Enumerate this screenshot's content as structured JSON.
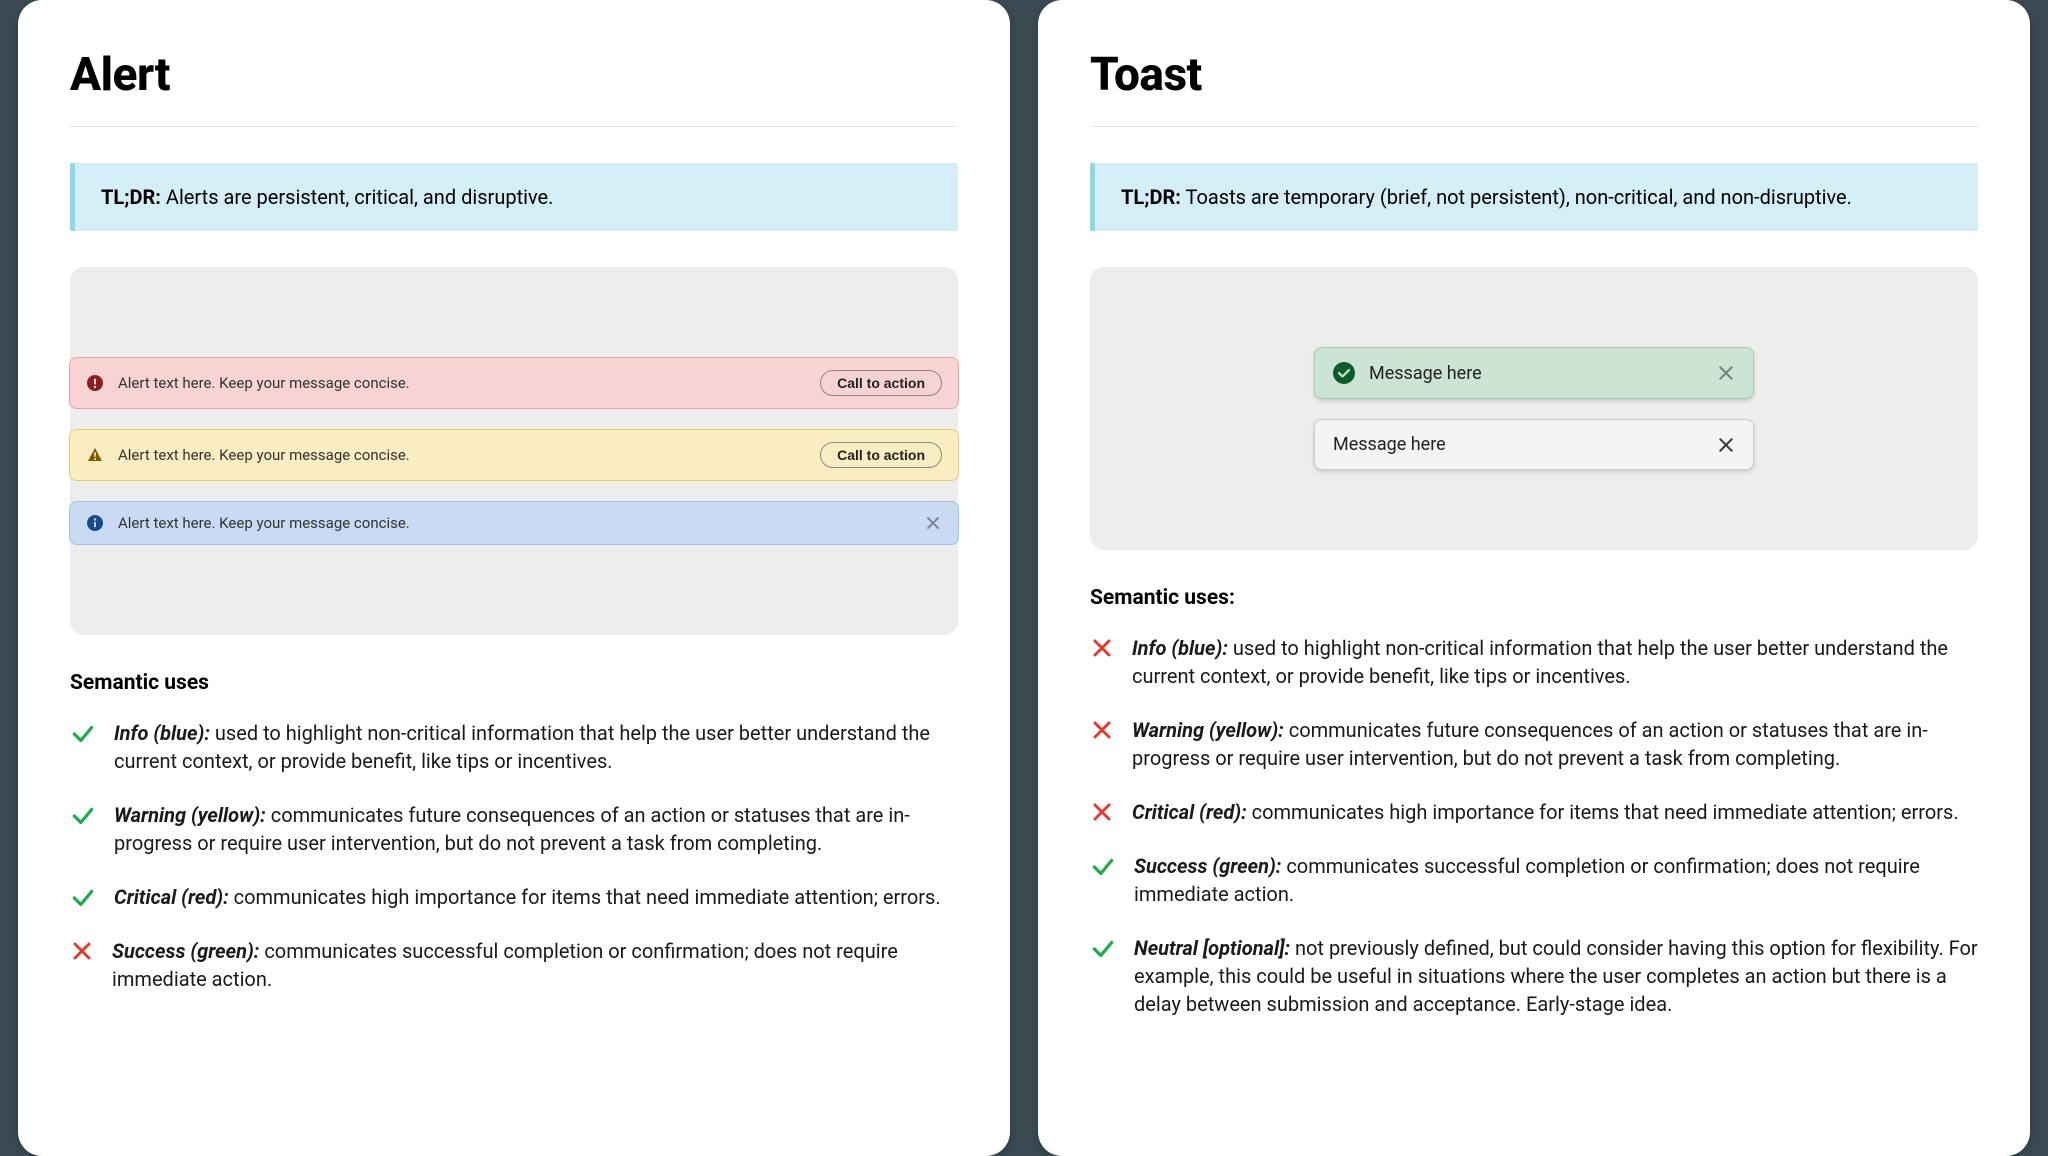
{
  "alert": {
    "title": "Alert",
    "tldr_label": "TL;DR:",
    "tldr_text": "Alerts are persistent, critical, and disruptive.",
    "examples": [
      {
        "kind": "critical",
        "text": "Alert text here. Keep your message concise.",
        "cta": "Call to action"
      },
      {
        "kind": "warning",
        "text": "Alert text here. Keep your message concise.",
        "cta": "Call to action"
      },
      {
        "kind": "info",
        "text": "Alert text here. Keep your message concise."
      }
    ],
    "semantic_heading": "Semantic uses",
    "uses": [
      {
        "mark": "check",
        "lead": "Info (blue):",
        "body": "used to highlight non-critical information that help the user better understand the current context, or provide benefit, like tips or incentives."
      },
      {
        "mark": "check",
        "lead": "Warning (yellow):",
        "body": "communicates future consequences of an action or statuses that are in-progress or require user intervention, but do not prevent a task from completing."
      },
      {
        "mark": "check",
        "lead": "Critical (red):",
        "body": "communicates high importance for items that need immediate attention; errors."
      },
      {
        "mark": "cross",
        "lead": "Success (green):",
        "body": "communicates successful completion or confirmation; does not require immediate action."
      }
    ]
  },
  "toast": {
    "title": "Toast",
    "tldr_label": "TL;DR:",
    "tldr_text": "Toasts are temporary (brief, not persistent), non-critical, and non-disruptive.",
    "examples": [
      {
        "kind": "success",
        "text": "Message here"
      },
      {
        "kind": "neutral",
        "text": "Message here"
      }
    ],
    "semantic_heading": "Semantic uses:",
    "uses": [
      {
        "mark": "cross",
        "lead": "Info (blue):",
        "body": "used to highlight non-critical information that help the user better understand the current context, or provide benefit, like tips or incentives."
      },
      {
        "mark": "cross",
        "lead": "Warning (yellow):",
        "body": "communicates future consequences of an action or statuses that are in-progress or require user intervention, but do not prevent a task from completing."
      },
      {
        "mark": "cross",
        "lead": "Critical (red):",
        "body": "communicates high importance for items that need immediate attention; errors."
      },
      {
        "mark": "check",
        "lead": "Success (green):",
        "body": "communicates successful completion or confirmation; does not require immediate action."
      },
      {
        "mark": "check",
        "lead": "Neutral [optional]:",
        "body": "not previously defined, but could consider having this option for flexibility. For example, this could be useful in situations where the user completes an action but there is a delay between submission and acceptance. Early-stage idea."
      }
    ]
  }
}
